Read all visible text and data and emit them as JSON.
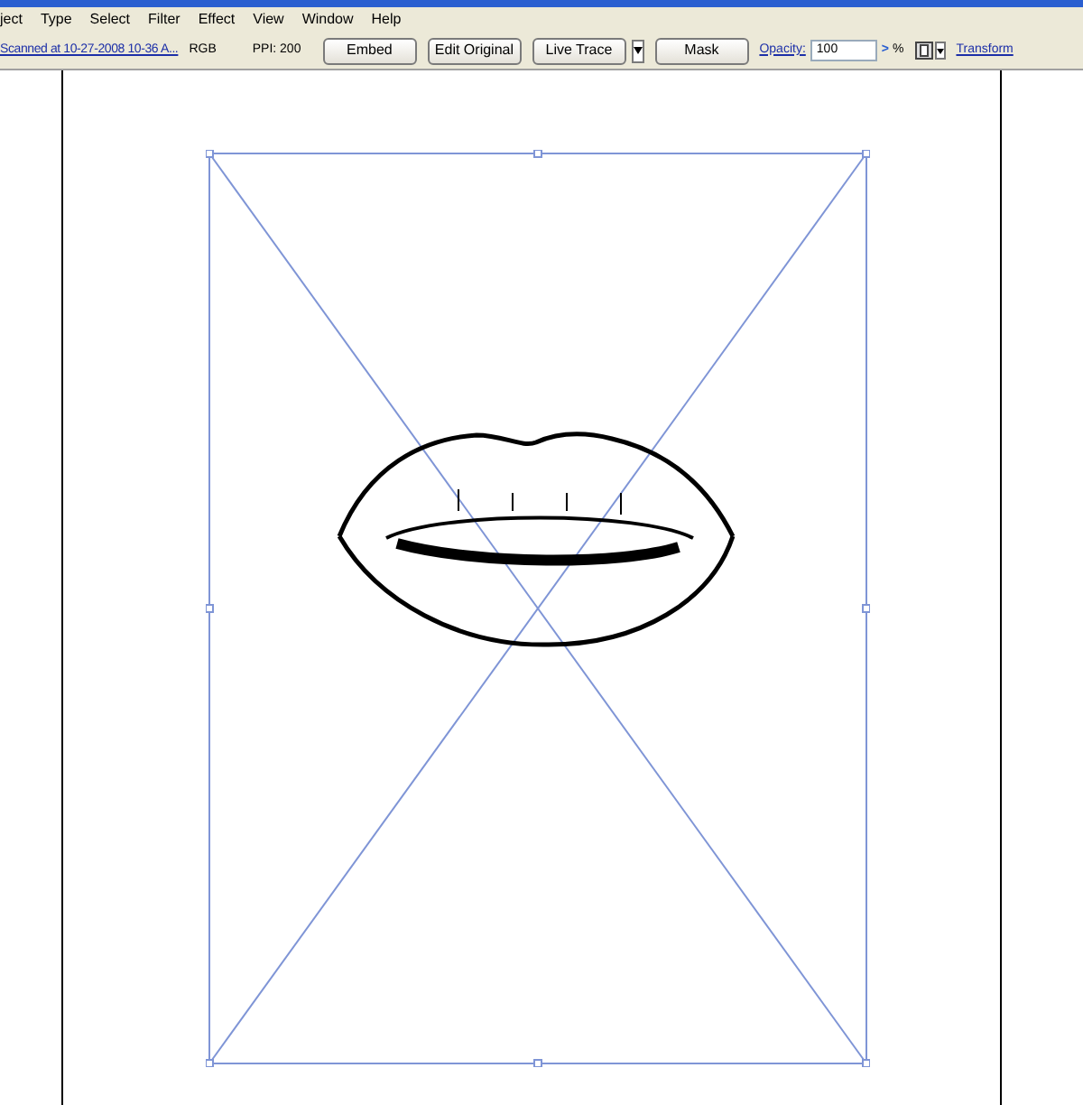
{
  "menu_bar": {
    "items": [
      "ject",
      "Type",
      "Select",
      "Filter",
      "Effect",
      "View",
      "Window",
      "Help"
    ]
  },
  "control_bar": {
    "file_link": "Scanned at 10-27-2008 10-36 A...",
    "color_mode": "RGB",
    "ppi": "PPI: 200",
    "buttons": [
      {
        "label": "Embed",
        "kind": "button"
      },
      {
        "label": "Edit Original",
        "kind": "button"
      },
      {
        "label": "Live Trace",
        "kind": "split"
      },
      {
        "label": "Mask",
        "kind": "button"
      }
    ],
    "opacity_label": "Opacity:",
    "opacity_value": "100",
    "opacity_arrow": ">",
    "percent": "%",
    "transform_link": "Transform"
  }
}
